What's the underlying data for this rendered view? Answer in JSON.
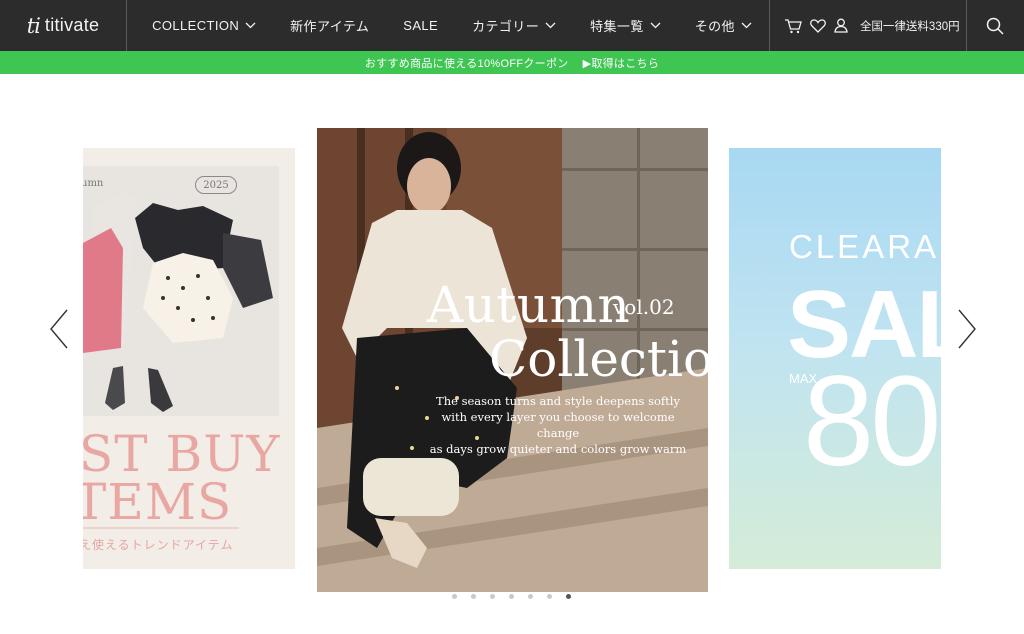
{
  "header": {
    "logo_mark": "ti",
    "logo_text": "titivate",
    "nav": [
      {
        "label": "COLLECTION",
        "has_dropdown": true
      },
      {
        "label": "新作アイテム",
        "has_dropdown": false
      },
      {
        "label": "SALE",
        "has_dropdown": false
      },
      {
        "label": "カテゴリー",
        "has_dropdown": true
      },
      {
        "label": "特集一覧",
        "has_dropdown": true
      },
      {
        "label": "その他",
        "has_dropdown": true
      }
    ],
    "icons": [
      "cart-icon",
      "heart-icon",
      "user-icon",
      "search-icon"
    ],
    "shipping_text": "全国一律送料330円"
  },
  "promo": {
    "text": "おすすめ商品に使える10%OFFクーポン",
    "link": "▶取得はこちら",
    "color": "#3ec552"
  },
  "carousel": {
    "left_slide": {
      "small_text": "umn",
      "year": "2025",
      "title_line1": "ST BUY",
      "title_line2": "TEMS",
      "subtitle": "え使えるトレンドアイテム"
    },
    "center_slide": {
      "title_line1": "Autumn",
      "volume": "vol.02",
      "title_line2": "Collection",
      "body_lines": [
        "The season turns and style deepens softly",
        "with every layer you choose to welcome change",
        "as days grow quieter and colors grow warm"
      ]
    },
    "right_slide": {
      "line1": "CLEARA",
      "line2": "SAL",
      "max_label": "MAX",
      "percent": "80"
    },
    "dot_count": 7,
    "active_dot": 7
  },
  "colors": {
    "header_bg": "#2c2c2c",
    "promo_bg": "#3ec552",
    "accent_pink": "#e8a7a2"
  }
}
